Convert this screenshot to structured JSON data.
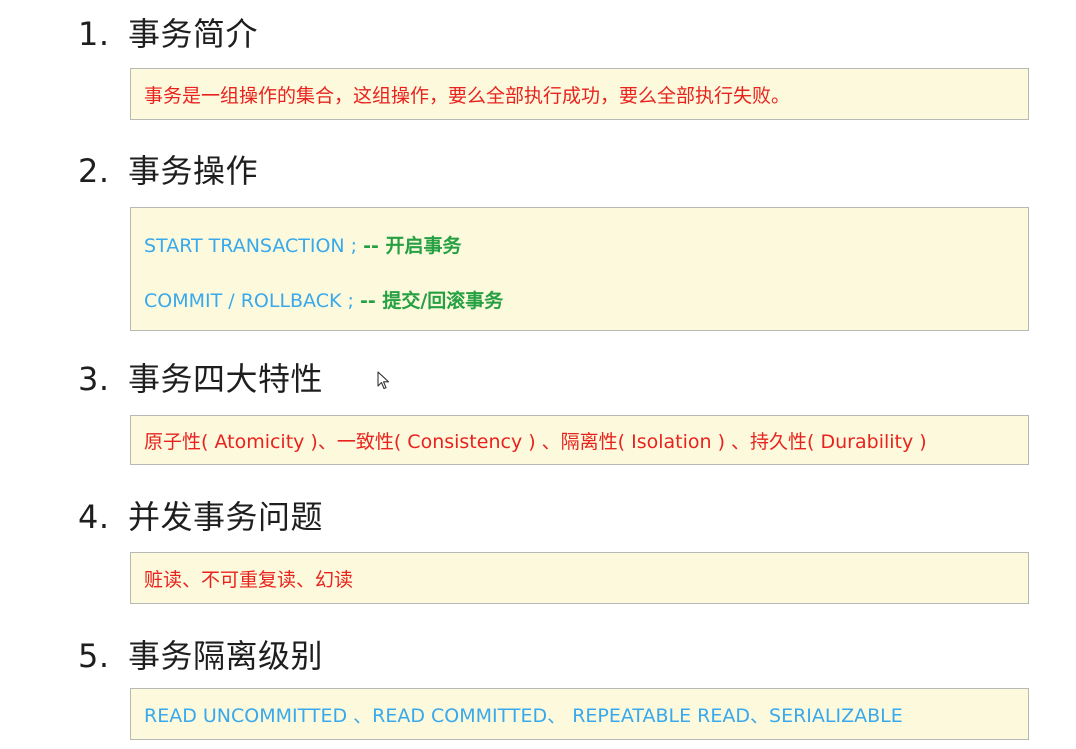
{
  "sections": [
    {
      "number": "1.",
      "title": "事务简介",
      "content": "事务是一组操作的集合，这组操作，要么全部执行成功，要么全部执行失败。"
    },
    {
      "number": "2.",
      "title": "事务操作",
      "lines": [
        {
          "code": "START  TRANSACTION ;",
          "comment": "-- 开启事务"
        },
        {
          "code": "COMMIT / ROLLBACK ;",
          "comment": "-- 提交/回滚事务"
        }
      ]
    },
    {
      "number": "3.",
      "title": "事务四大特性",
      "content": "原子性( Atomicity )、一致性( Consistency ) 、隔离性( Isolation ) 、持久性( Durability )"
    },
    {
      "number": "4.",
      "title": "并发事务问题",
      "content": "赃读、不可重复读、幻读"
    },
    {
      "number": "5.",
      "title": "事务隔离级别",
      "content": "READ UNCOMMITTED 、READ COMMITTED、 REPEATABLE READ、SERIALIZABLE"
    }
  ],
  "colors": {
    "highlight_text": "#e8231f",
    "sql_text": "#38a9ec",
    "comment_text": "#25a042",
    "box_background": "#fdf9dc"
  },
  "icons": {
    "cursor": "mouse-pointer-icon"
  }
}
